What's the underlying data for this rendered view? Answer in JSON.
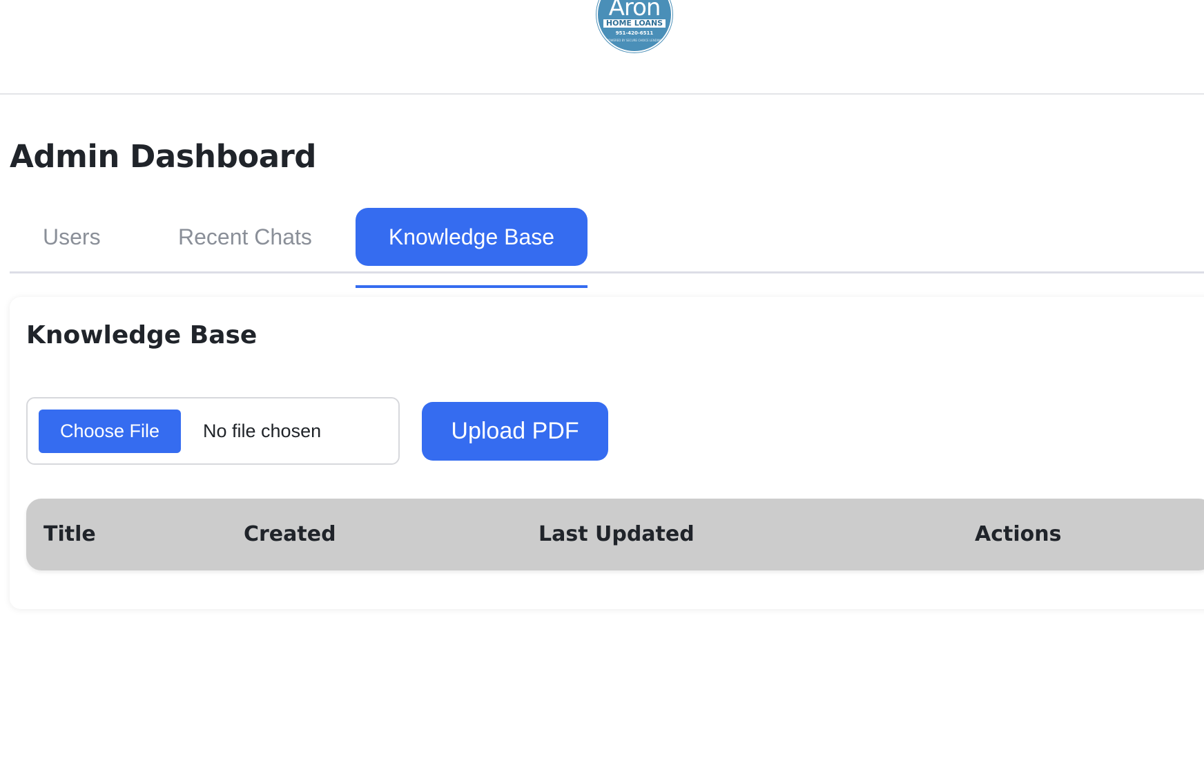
{
  "logo": {
    "name": "Aron",
    "subtitle": "HOME LOANS",
    "phone": "951-420-6511",
    "tagline": "POWERED BY SECURE CHOICE LENDING"
  },
  "page": {
    "title": "Admin Dashboard"
  },
  "tabs": [
    {
      "label": "Users",
      "active": false
    },
    {
      "label": "Recent Chats",
      "active": false
    },
    {
      "label": "Knowledge Base",
      "active": true
    }
  ],
  "knowledge_base": {
    "title": "Knowledge Base",
    "file_input": {
      "button_label": "Choose File",
      "status": "No file chosen"
    },
    "upload_label": "Upload PDF",
    "table": {
      "columns": [
        "Title",
        "Created",
        "Last Updated",
        "Actions"
      ],
      "rows": []
    }
  },
  "colors": {
    "accent": "#356cf0",
    "logo": "#4a8fb8",
    "table_header": "#cccccc",
    "inactive_tab_text": "#8a8f98"
  }
}
